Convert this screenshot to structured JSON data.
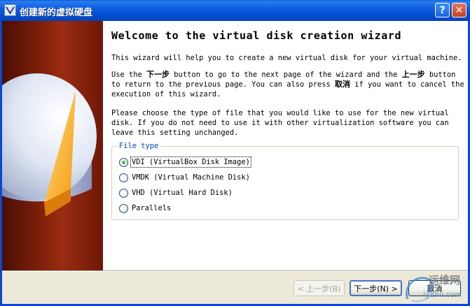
{
  "window": {
    "title": "创建新的虚拟硬盘",
    "help_label": "?",
    "close_label": "✕"
  },
  "wizard": {
    "heading": "Welcome to the virtual disk creation wizard",
    "intro": "This wizard will help you to create a new virtual disk for your virtual machine.",
    "nav_line1_a": "Use the ",
    "nav_line1_next": "下一步",
    "nav_line1_b": " button to go to the next page of the wizard and the ",
    "nav_line1_back": "上一步",
    "nav_line1_c": " button",
    "nav_line2_a": "to return to the previous page. You can also press ",
    "nav_line2_cancel": "取消",
    "nav_line2_b": " if you want to cancel the",
    "nav_line3": "execution of this wizard.",
    "choose_line1": "Please choose the type of file that you would like to use for the new virtual",
    "choose_line2": "disk. If you do not need to use it with other virtualization software you can",
    "choose_line3": "leave this setting unchanged."
  },
  "file_type": {
    "legend": "File type",
    "options": [
      {
        "label": "VDI (VirtualBox Disk Image)",
        "checked": true
      },
      {
        "label": "VMDK (Virtual Machine Disk)",
        "checked": false
      },
      {
        "label": "VHD (Virtual Hard Disk)",
        "checked": false
      },
      {
        "label": "Parallels",
        "checked": false
      }
    ]
  },
  "buttons": {
    "back": "< 上一步(B)",
    "next": "下一步(N) >",
    "cancel": "取消"
  },
  "watermark": {
    "line1": "运维网",
    "line2": "iyunv.com"
  },
  "colors": {
    "titlebar": "#0054e3",
    "banner": "#7a1e0a",
    "legend": "#0046d5",
    "radio_check": "#1f8f1f"
  }
}
